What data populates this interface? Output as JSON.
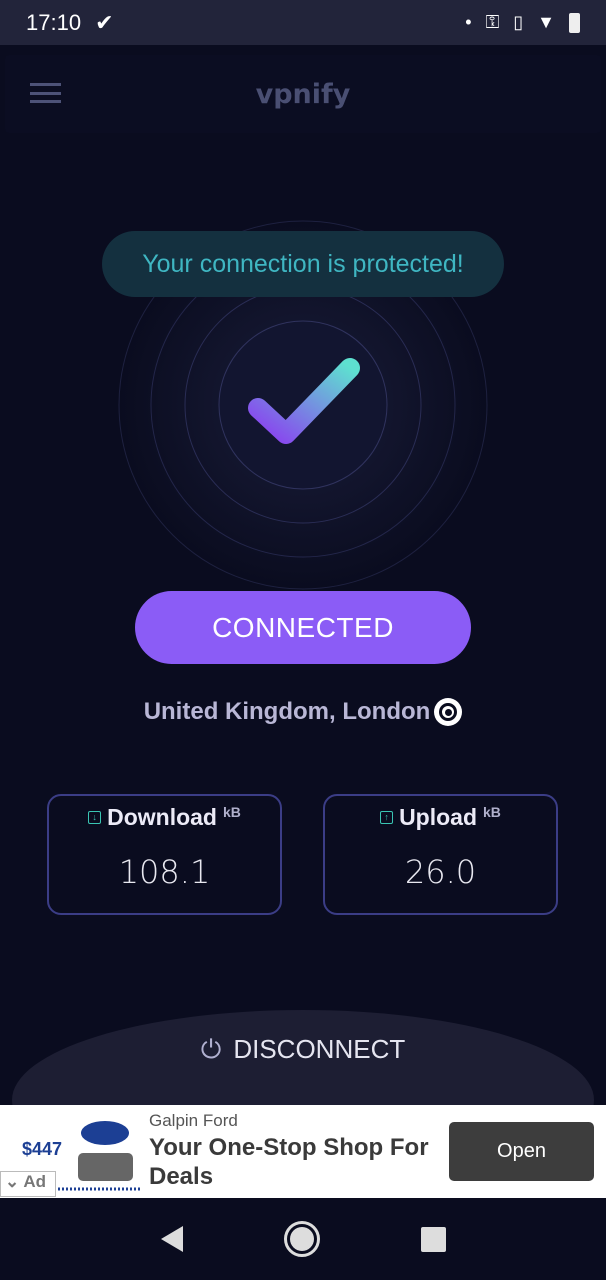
{
  "status_bar": {
    "time": "17:10"
  },
  "app": {
    "title": "vpnify"
  },
  "main": {
    "status_message": "Your connection is protected!",
    "connect_button": "CONNECTED",
    "location": "United Kingdom, London"
  },
  "stats": [
    {
      "label": "Download",
      "unit": "kB",
      "value": "108.1"
    },
    {
      "label": "Upload",
      "unit": "kB",
      "value": "26.0"
    }
  ],
  "disconnect": {
    "label": "DISCONNECT"
  },
  "ad": {
    "advertiser": "Galpin Ford",
    "headline": "Your One-Stop Shop For Deals",
    "cta": "Open",
    "badge": "Ad",
    "image_price": "$447"
  },
  "colors": {
    "accent": "#8b5cf6",
    "teal": "#3fb6c2",
    "background": "#0a0c1f"
  }
}
